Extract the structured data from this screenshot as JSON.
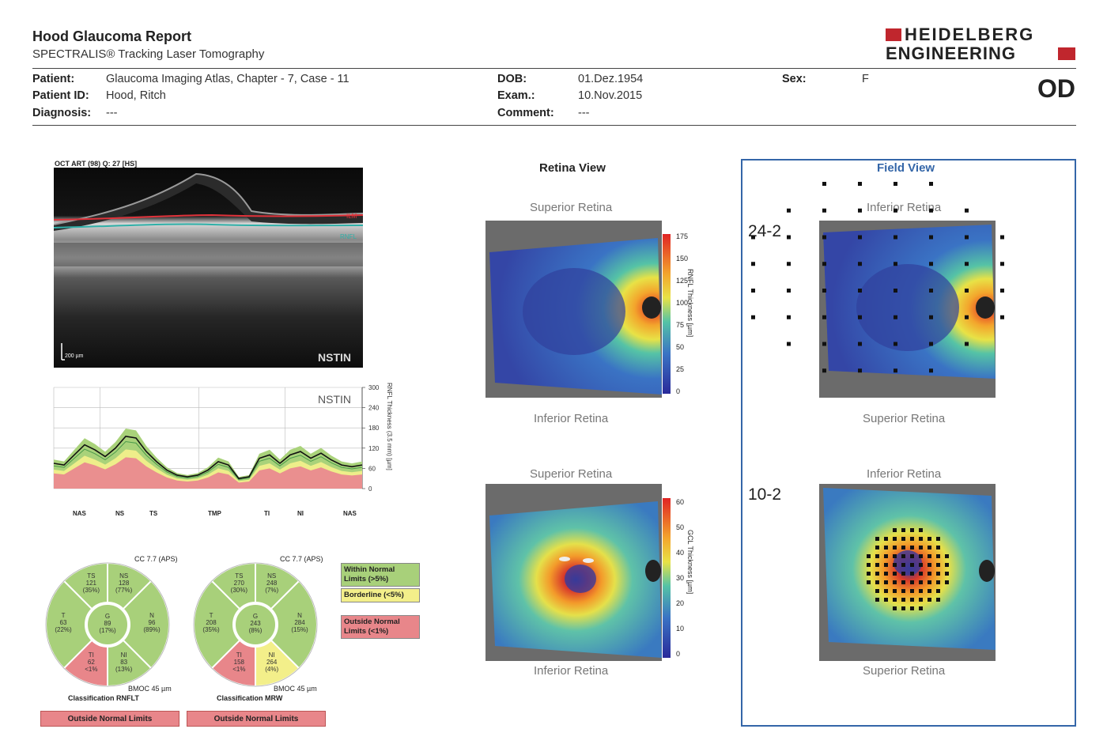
{
  "header": {
    "title": "Hood Glaucoma Report",
    "subtitle": "SPECTRALIS® Tracking Laser Tomography",
    "logo_line1": "HEIDELBERG",
    "logo_line2": "ENGINEERING",
    "brand_color": "#c0262d"
  },
  "patient": {
    "patient_label": "Patient:",
    "patient_value": "Glaucoma Imaging Atlas, Chapter - 7, Case  - 11",
    "id_label": "Patient ID:",
    "id_value": "Hood, Ritch",
    "diag_label": "Diagnosis:",
    "diag_value": "---",
    "dob_label": "DOB:",
    "dob_value": "01.Dez.1954",
    "exam_label": "Exam.:",
    "exam_value": "10.Nov.2015",
    "comment_label": "Comment:",
    "comment_value": "---",
    "sex_label": "Sex:",
    "sex_value": "F",
    "eye": "OD"
  },
  "bscan": {
    "caption": "OCT ART (98) Q: 27 [HS]",
    "scale": "200 µm",
    "direction": "NSTIN",
    "ilm": "ILM",
    "rnfl": "RNFL"
  },
  "profile": {
    "direction": "NSTIN",
    "axis_label": "RNFL Thickness (3.5 mm) [µm]",
    "ticks": [
      "300",
      "240",
      "180",
      "120",
      "60",
      "0"
    ],
    "sectors": [
      "NAS",
      "NS",
      "TS",
      "TMP",
      "TI",
      "NI",
      "NAS"
    ]
  },
  "classification_rnflt": {
    "cc": "CC 7.7 (APS)",
    "sectors": {
      "TS": {
        "name": "TS",
        "value": "121",
        "pct": "(35%)"
      },
      "NS": {
        "name": "NS",
        "value": "128",
        "pct": "(77%)"
      },
      "T": {
        "name": "T",
        "value": "63",
        "pct": "(22%)"
      },
      "G": {
        "name": "G",
        "value": "89",
        "pct": "(17%)"
      },
      "N": {
        "name": "N",
        "value": "96",
        "pct": "(89%)"
      },
      "TI": {
        "name": "TI",
        "value": "62",
        "pct": "<1%"
      },
      "NI": {
        "name": "NI",
        "value": "83",
        "pct": "(13%)"
      }
    },
    "bmo": "BMOC 45 µm",
    "title": "Classification RNFLT",
    "status": "Outside Normal Limits"
  },
  "classification_mrw": {
    "cc": "CC 7.7 (APS)",
    "sectors": {
      "TS": {
        "name": "TS",
        "value": "270",
        "pct": "(30%)"
      },
      "NS": {
        "name": "NS",
        "value": "248",
        "pct": "(7%)"
      },
      "T": {
        "name": "T",
        "value": "208",
        "pct": "(35%)"
      },
      "G": {
        "name": "G",
        "value": "243",
        "pct": "(8%)"
      },
      "N": {
        "name": "N",
        "value": "284",
        "pct": "(15%)"
      },
      "TI": {
        "name": "TI",
        "value": "158",
        "pct": "<1%"
      },
      "NI": {
        "name": "NI",
        "value": "264",
        "pct": "(4%)"
      }
    },
    "bmo": "BMOC 45 µm",
    "title": "Classification MRW",
    "status": "Outside Normal Limits"
  },
  "legend": {
    "within": "Within Normal Limits (>5%)",
    "borderline": "Borderline (<5%)",
    "outside": "Outside Normal Limits (<1%)",
    "colors": {
      "within": "#a8d07a",
      "borderline": "#f3ef8a",
      "outside": "#e8868a"
    }
  },
  "retina_view": {
    "title": "Retina View",
    "map1_top": "Superior Retina",
    "map1_bottom": "Inferior Retina",
    "map1_axis": "RNFL Thickness [µm]",
    "map1_ticks": [
      "175",
      "150",
      "125",
      "100",
      "75",
      "50",
      "25",
      "0"
    ],
    "map2_top": "Superior Retina",
    "map2_bottom": "Inferior Retina",
    "map2_axis": "GCL Thickness [µm]",
    "map2_ticks": [
      "60",
      "50",
      "40",
      "30",
      "20",
      "10",
      "0"
    ]
  },
  "field_view": {
    "title": "Field View",
    "map1_label": "24-2",
    "map1_top": "Inferior Retina",
    "map1_bottom": "Superior Retina",
    "map2_label": "10-2",
    "map2_top": "Inferior Retina",
    "map2_bottom": "Superior Retina"
  },
  "chart_data": {
    "type": "line",
    "title": "",
    "xlabel": "",
    "ylabel": "RNFL Thickness (3.5 mm) [µm]",
    "ylim": [
      0,
      300
    ],
    "categories": [
      "NAS",
      "NS",
      "TS",
      "TMP",
      "TI",
      "NI",
      "NAS"
    ],
    "series": [
      {
        "values": [
          75,
          70,
          100,
          130,
          115,
          95,
          120,
          155,
          150,
          110,
          80,
          55,
          40,
          35,
          40,
          55,
          80,
          70,
          30,
          35,
          90,
          100,
          75,
          100,
          110,
          90,
          105,
          85,
          70,
          65,
          70
        ]
      }
    ]
  }
}
